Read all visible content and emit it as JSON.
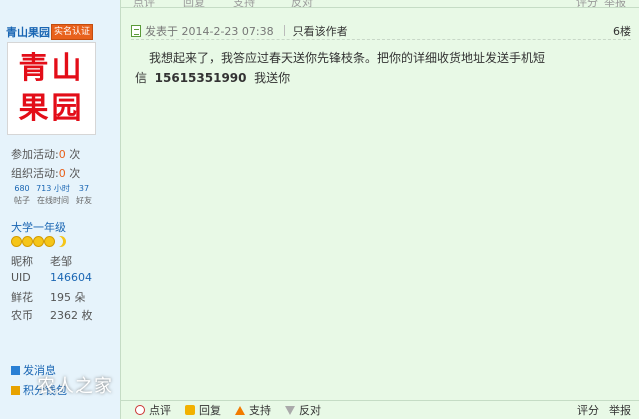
{
  "topbar": {
    "items": [
      "点评",
      "回复",
      "支持",
      "反对"
    ],
    "right_items": [
      "评分",
      "举报"
    ]
  },
  "user": {
    "name": "青山果园",
    "badge": "实名认证",
    "avatar_text": [
      "青山",
      "果园"
    ],
    "activity_join_label": "参加活动:",
    "activity_join_count": "0",
    "activity_join_unit": "次",
    "activity_org_label": "组织活动:",
    "activity_org_count": "0",
    "activity_org_unit": "次",
    "stats": [
      {
        "value": "680",
        "label": "帖子"
      },
      {
        "value": "713 小时",
        "label": "在线时间"
      },
      {
        "value": "37",
        "label": "好友"
      }
    ],
    "level": "大学一年级",
    "info": [
      {
        "key": "昵称",
        "value": "老邹"
      },
      {
        "key": "UID",
        "value": "146604"
      },
      {
        "key": "鲜花",
        "value": "195 朵"
      },
      {
        "key": "农币",
        "value": "2362 枚"
      }
    ],
    "links": [
      "发消息",
      "积分钱包"
    ]
  },
  "watermark": "农人之家",
  "post": {
    "posted_at": "发表于 2014-2-23 07:38",
    "only_author": "只看该作者",
    "floor": "6楼",
    "text_line1": "我想起来了，我答应过春天送你先锋枝条。把你的详细收货地址发送手机短",
    "text_line2_prefix": "信",
    "phone": "15615351990",
    "text_line2_suffix": "我送你"
  },
  "actions": {
    "comment": "点评",
    "reply": "回复",
    "support": "支持",
    "oppose": "反对",
    "rate": "评分",
    "report": "举报"
  },
  "colors": {
    "sidebar_bg": "#e6f3fb",
    "main_bg": "#e8f9e6",
    "link": "#1a66b3",
    "badge": "#e8611c",
    "avatar_text": "#e30d18"
  }
}
